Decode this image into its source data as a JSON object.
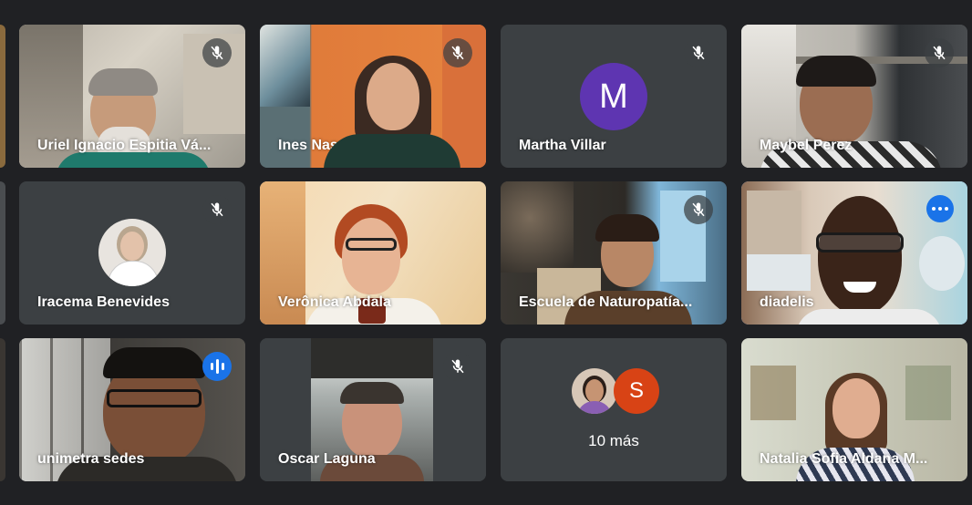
{
  "participants": [
    {
      "name": "Uriel Ignacio Espitia Vá...",
      "status": "muted"
    },
    {
      "name": "Ines Nascimento de Ca...",
      "status": "muted"
    },
    {
      "name": "Martha Villar",
      "status": "muted",
      "avatar_letter": "M"
    },
    {
      "name": "Maybel Perez",
      "status": "muted"
    },
    {
      "name": "Iracema Benevides",
      "status": "muted"
    },
    {
      "name": "Verônica Abdala",
      "status": "unmuted"
    },
    {
      "name": "Escuela de Naturopatía...",
      "status": "muted"
    },
    {
      "name": "diadelis",
      "status": "unmuted",
      "pinned_options": true
    },
    {
      "name": "unimetra sedes",
      "status": "speaking"
    },
    {
      "name": "Oscar Laguna",
      "status": "muted"
    },
    {
      "name": "Natalia Sofia Aldana M...",
      "status": "unmuted"
    }
  ],
  "overflow": {
    "avatar_letter": "S",
    "label": "10 más"
  },
  "colors": {
    "background": "#202124",
    "tile": "#3c4043",
    "accent": "#1a73e8",
    "active_border": "#8ab4f8",
    "avatar_m": "#5e35b1",
    "avatar_s": "#d84315"
  },
  "icons": {
    "muted": "mic-off-icon",
    "speaking": "audio-level-icon",
    "options": "more-options-icon"
  }
}
